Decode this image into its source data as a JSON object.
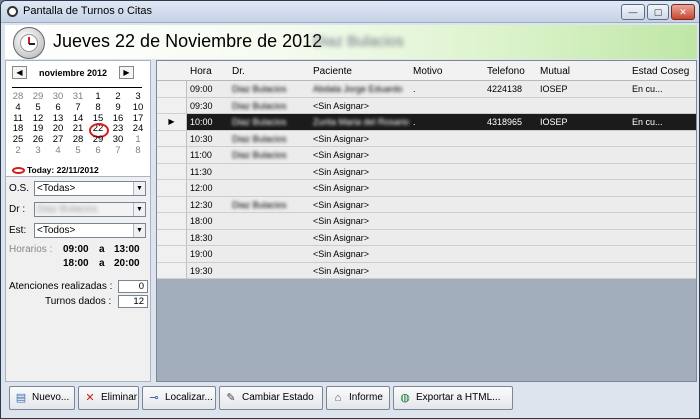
{
  "window": {
    "title": "Pantalla de Turnos o Citas",
    "min_label": "—",
    "max_label": "▢",
    "close_label": "✕"
  },
  "header": {
    "date": "Jueves 22 de Noviembre de 2012",
    "doctor": "Diaz Bulacios"
  },
  "calendar": {
    "month": "noviembre 2012",
    "prev_label": "◀",
    "next_label": "▶",
    "days": [
      [
        "28",
        "29",
        "30",
        "31",
        "1",
        "2",
        "3"
      ],
      [
        "4",
        "5",
        "6",
        "7",
        "8",
        "9",
        "10"
      ],
      [
        "11",
        "12",
        "13",
        "14",
        "15",
        "16",
        "17"
      ],
      [
        "18",
        "19",
        "20",
        "21",
        "22",
        "23",
        "24"
      ],
      [
        "25",
        "26",
        "27",
        "28",
        "29",
        "30",
        "1"
      ],
      [
        "2",
        "3",
        "4",
        "5",
        "6",
        "7",
        "8"
      ]
    ],
    "today_label": "Today: 22/11/2012"
  },
  "filters": {
    "os_label": "O.S.",
    "os_value": "<Todas>",
    "dr_label": "Dr :",
    "dr_value": "Diaz Bulacios",
    "est_label": "Est:",
    "est_value": "<Todos>"
  },
  "horarios": {
    "label": "Horarios :",
    "r1a": "09:00",
    "a1": "a",
    "r1b": "13:00",
    "r2a": "18:00",
    "a2": "a",
    "r2b": "20:00"
  },
  "counts": {
    "atenciones_label": "Atenciones realizadas :",
    "atenciones": "0",
    "turnos_label": "Turnos dados :",
    "turnos": "12"
  },
  "table": {
    "columns": [
      "Hora",
      "Dr.",
      "Paciente",
      "Motivo",
      "Telefono",
      "Mutual",
      "Estad Coseg"
    ],
    "rows": [
      {
        "hora": "09:00",
        "dr": "Diaz Bulacios",
        "paciente": "Abdala Jorge Eduardo",
        "motivo": ".",
        "telefono": "4224138",
        "mutual": "IOSEP",
        "estado": "En cu..."
      },
      {
        "hora": "09:30",
        "dr": "Diaz Bulacios",
        "paciente": "<Sin Asignar>",
        "motivo": "",
        "telefono": "",
        "mutual": "",
        "estado": ""
      },
      {
        "hora": "10:00",
        "dr": "Diaz Bulacios",
        "paciente": "Zurita Maria del Rosario",
        "motivo": ".",
        "telefono": "4318965",
        "mutual": "IOSEP",
        "estado": "En cu..."
      },
      {
        "hora": "10:30",
        "dr": "Diaz Bulacios",
        "paciente": "<Sin Asignar>",
        "motivo": "",
        "telefono": "",
        "mutual": "",
        "estado": ""
      },
      {
        "hora": "11:00",
        "dr": "Diaz Bulacios",
        "paciente": "<Sin Asignar>",
        "motivo": "",
        "telefono": "",
        "mutual": "",
        "estado": ""
      },
      {
        "hora": "11:30",
        "dr": "",
        "paciente": "<Sin Asignar>",
        "motivo": "",
        "telefono": "",
        "mutual": "",
        "estado": ""
      },
      {
        "hora": "12:00",
        "dr": "",
        "paciente": "<Sin Asignar>",
        "motivo": "",
        "telefono": "",
        "mutual": "",
        "estado": ""
      },
      {
        "hora": "12:30",
        "dr": "Diaz Bulacios",
        "paciente": "<Sin Asignar>",
        "motivo": "",
        "telefono": "",
        "mutual": "",
        "estado": ""
      },
      {
        "hora": "18:00",
        "dr": "",
        "paciente": "<Sin Asignar>",
        "motivo": "",
        "telefono": "",
        "mutual": "",
        "estado": ""
      },
      {
        "hora": "18:30",
        "dr": "",
        "paciente": "<Sin Asignar>",
        "motivo": "",
        "telefono": "",
        "mutual": "",
        "estado": ""
      },
      {
        "hora": "19:00",
        "dr": "",
        "paciente": "<Sin Asignar>",
        "motivo": "",
        "telefono": "",
        "mutual": "",
        "estado": ""
      },
      {
        "hora": "19:30",
        "dr": "",
        "paciente": "<Sin Asignar>",
        "motivo": "",
        "telefono": "",
        "mutual": "",
        "estado": ""
      }
    ],
    "current_row_marker": "▶"
  },
  "buttons": {
    "nuevo": "Nuevo...",
    "eliminar": "Eliminar",
    "localizar": "Localizar...",
    "cambiar": "Cambiar Estado",
    "informe": "Informe",
    "exportar": "Exportar a HTML..."
  }
}
